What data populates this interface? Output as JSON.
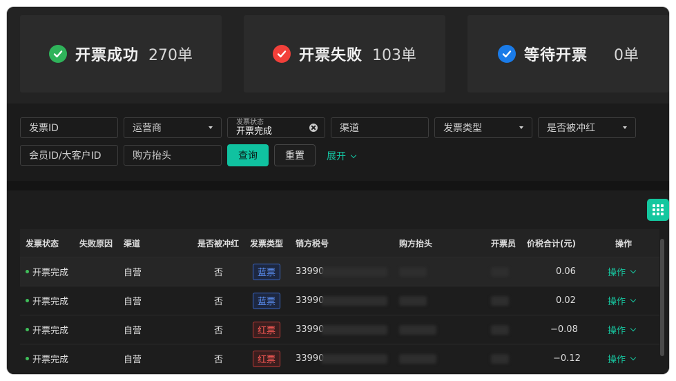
{
  "stats": [
    {
      "label": "开票成功",
      "count": "270单",
      "icon": "check-circle-icon",
      "color": "#2fb35a"
    },
    {
      "label": "开票失败",
      "count": "103单",
      "icon": "check-circle-icon",
      "color": "#f2403a"
    },
    {
      "label": "等待开票",
      "count": "0单",
      "icon": "check-circle-icon",
      "color": "#1a7be8"
    }
  ],
  "filters": {
    "invoice_id_placeholder": "发票ID",
    "operator_placeholder": "运营商",
    "invoice_status_label": "发票状态",
    "invoice_status_value": "开票完成",
    "channel_placeholder": "渠道",
    "invoice_type_placeholder": "发票类型",
    "red_flush_placeholder": "是否被冲红",
    "member_id_placeholder": "会员ID/大客户ID",
    "buyer_title_placeholder": "购方抬头",
    "query_label": "查询",
    "reset_label": "重置",
    "expand_label": "展开"
  },
  "table": {
    "headers": [
      "发票状态",
      "失败原因",
      "渠道",
      "是否被冲红",
      "发票类型",
      "销方税号",
      "购方抬头",
      "开票员",
      "价税合计(元)",
      "操作"
    ],
    "rows": [
      {
        "status": "开票完成",
        "channel": "自营",
        "red": "否",
        "type": "蓝票",
        "type_color": "blue",
        "tax_id": "33990",
        "amount": "0.06",
        "op": "操作"
      },
      {
        "status": "开票完成",
        "channel": "自营",
        "red": "否",
        "type": "蓝票",
        "type_color": "blue",
        "tax_id": "33990",
        "amount": "0.02",
        "op": "操作"
      },
      {
        "status": "开票完成",
        "channel": "自营",
        "red": "否",
        "type": "红票",
        "type_color": "red",
        "tax_id": "33990",
        "amount": "−0.08",
        "op": "操作"
      },
      {
        "status": "开票完成",
        "channel": "自营",
        "red": "否",
        "type": "红票",
        "type_color": "red",
        "tax_id": "33990",
        "amount": "−0.12",
        "op": "操作"
      }
    ]
  }
}
